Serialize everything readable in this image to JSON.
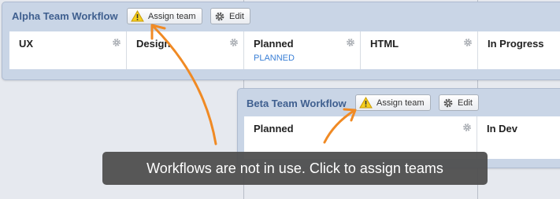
{
  "alpha": {
    "title": "Alpha Team Workflow",
    "assign_label": "Assign team",
    "edit_label": "Edit",
    "states": [
      {
        "name": "UX",
        "sub": ""
      },
      {
        "name": "Design",
        "sub": ""
      },
      {
        "name": "Planned",
        "sub": "PLANNED"
      },
      {
        "name": "HTML",
        "sub": ""
      },
      {
        "name": "In Progress",
        "sub": ""
      }
    ]
  },
  "beta": {
    "title": "Beta Team Workflow",
    "assign_label": "Assign team",
    "edit_label": "Edit",
    "states": [
      {
        "name": "Planned",
        "sub": ""
      },
      {
        "name": "In Dev",
        "sub": ""
      }
    ]
  },
  "tooltip": {
    "text": "Workflows are not in use. Click to assign teams"
  },
  "icons": {
    "warning": "warning-icon",
    "edit": "gear-icon",
    "state_settings": "gear-icon",
    "pointer": "arrow-icon"
  },
  "colors": {
    "arrow": "#f08a24",
    "title": "#3f5f8f",
    "panel": "#c9d5e6",
    "sublabel": "#3a7fd6"
  }
}
